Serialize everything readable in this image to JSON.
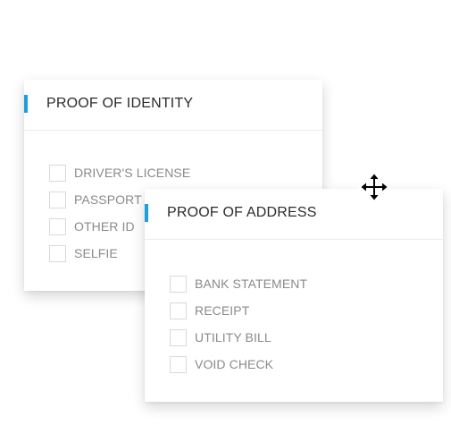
{
  "colors": {
    "accent": "#1aa0e0",
    "title_text": "#2b2b2b",
    "option_text": "#8a8a8a",
    "checkbox_border": "#d9d9d9"
  },
  "cards": {
    "identity": {
      "title": "PROOF OF IDENTITY",
      "options": [
        {
          "label": "DRIVER'S LICENSE",
          "checked": false
        },
        {
          "label": "PASSPORT",
          "checked": false
        },
        {
          "label": "OTHER ID",
          "checked": false
        },
        {
          "label": "SELFIE",
          "checked": false
        }
      ]
    },
    "address": {
      "title": "PROOF OF ADDRESS",
      "options": [
        {
          "label": "BANK STATEMENT",
          "checked": false
        },
        {
          "label": "RECEIPT",
          "checked": false
        },
        {
          "label": "UTILITY BILL",
          "checked": false
        },
        {
          "label": "VOID CHECK",
          "checked": false
        }
      ]
    }
  },
  "cursor": {
    "icon": "move-cursor-icon"
  }
}
